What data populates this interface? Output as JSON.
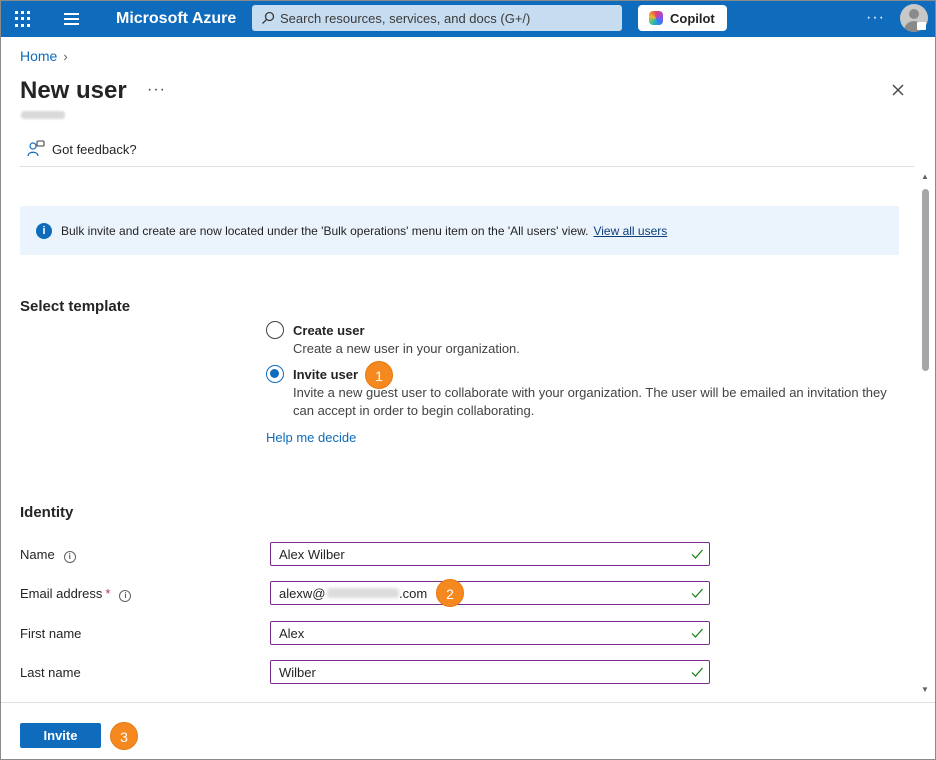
{
  "topbar": {
    "brand": "Microsoft Azure",
    "search_placeholder": "Search resources, services, and docs (G+/)",
    "copilot_label": "Copilot"
  },
  "breadcrumb": {
    "home": "Home"
  },
  "page": {
    "title": "New user"
  },
  "feedback": {
    "label": "Got feedback?"
  },
  "banner": {
    "message": "Bulk invite and create are now located under the 'Bulk operations' menu item on the 'All users' view.",
    "link": "View all users"
  },
  "template": {
    "heading": "Select template",
    "options": [
      {
        "label": "Create user",
        "description": "Create a new user in your organization.",
        "selected": false
      },
      {
        "label": "Invite user",
        "description": "Invite a new guest user to collaborate with your organization. The user will be emailed an invitation they can accept in order to begin collaborating.",
        "selected": true
      }
    ],
    "help_link": "Help me decide"
  },
  "identity": {
    "heading": "Identity",
    "fields": {
      "name": {
        "label": "Name",
        "value": "Alex Wilber"
      },
      "email": {
        "label": "Email address",
        "required_mark": "*",
        "prefix": "alexw@",
        "suffix": ".com"
      },
      "first_name": {
        "label": "First name",
        "value": "Alex"
      },
      "last_name": {
        "label": "Last name",
        "value": "Wilber"
      }
    }
  },
  "callouts": [
    "1",
    "2",
    "3"
  ],
  "footer": {
    "invite_label": "Invite"
  },
  "colors": {
    "accent": "#0f6cbd",
    "callout": "#f5891f",
    "field_border": "#7b2d8f",
    "valid_check": "#107c10"
  }
}
